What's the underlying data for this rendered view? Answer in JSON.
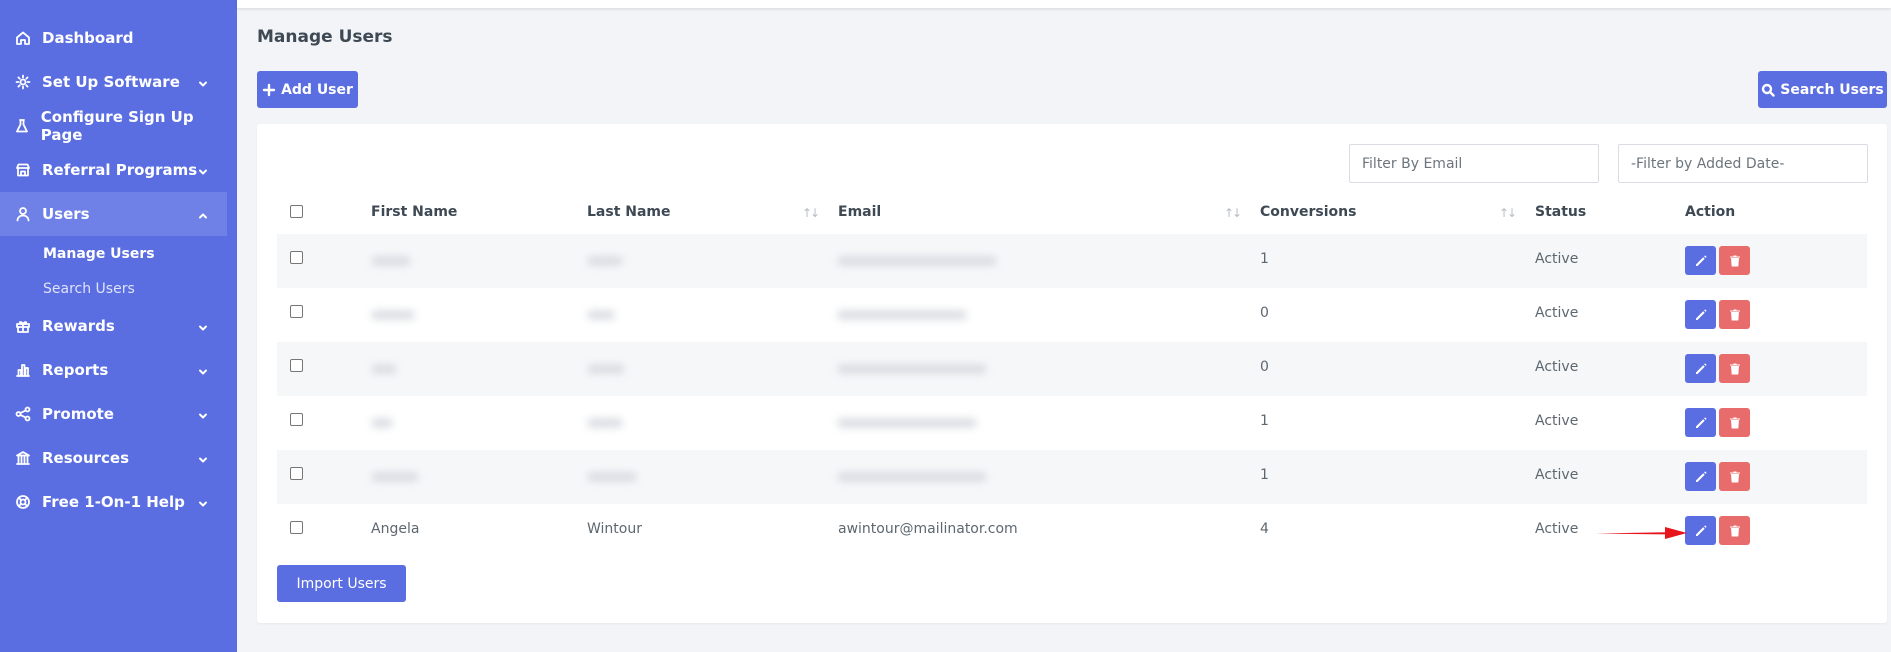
{
  "sidebar": {
    "items": [
      {
        "label": "Dashboard",
        "icon": "home-icon"
      },
      {
        "label": "Set Up Software",
        "icon": "gear-icon"
      },
      {
        "label": "Configure Sign Up Page",
        "icon": "flask-icon"
      },
      {
        "label": "Referral Programs",
        "icon": "store-icon"
      },
      {
        "label": "Users",
        "icon": "user-icon"
      },
      {
        "label": "Rewards",
        "icon": "gift-icon"
      },
      {
        "label": "Reports",
        "icon": "bar-chart-icon"
      },
      {
        "label": "Promote",
        "icon": "share-icon"
      },
      {
        "label": "Resources",
        "icon": "bank-icon"
      },
      {
        "label": "Free 1-On-1 Help",
        "icon": "lifebuoy-icon"
      }
    ],
    "users_sub": [
      {
        "label": "Manage Users"
      },
      {
        "label": "Search Users"
      }
    ]
  },
  "page": {
    "title": "Manage Users",
    "add_user_label": "Add User",
    "search_users_label": "Search Users",
    "import_users_label": "Import Users"
  },
  "filters": {
    "email_placeholder": "Filter By Email",
    "date_placeholder": "-Filter by Added Date-"
  },
  "table": {
    "headers": [
      "First Name",
      "Last Name",
      "Email",
      "Conversions",
      "Status",
      "Action"
    ],
    "rows": [
      {
        "first": "",
        "last": "",
        "email": "",
        "conversions": "1",
        "status": "Active"
      },
      {
        "first": "",
        "last": "",
        "email": "",
        "conversions": "0",
        "status": "Active"
      },
      {
        "first": "",
        "last": "",
        "email": "",
        "conversions": "0",
        "status": "Active"
      },
      {
        "first": "",
        "last": "",
        "email": "",
        "conversions": "1",
        "status": "Active"
      },
      {
        "first": "",
        "last": "",
        "email": "",
        "conversions": "1",
        "status": "Active"
      },
      {
        "first": "Angela",
        "last": "Wintour",
        "email": "awintour@mailinator.com",
        "conversions": "4",
        "status": "Active"
      }
    ]
  },
  "colors": {
    "sidebar": "#5b6ee1",
    "primary": "#5b6ee1",
    "danger": "#e96c6c",
    "annotation_arrow": "#e8141b"
  }
}
